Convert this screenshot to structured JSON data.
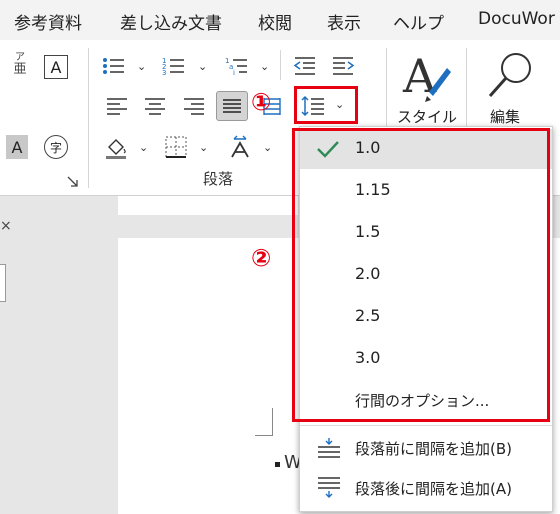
{
  "menu": {
    "items": [
      "参考資料",
      "差し込み文書",
      "校閲",
      "表示",
      "ヘルプ",
      "DocuWor"
    ]
  },
  "ribbon": {
    "phonetic_top": "ア",
    "phonetic_bottom": "亜",
    "char_border": "A",
    "char_shading": "A",
    "enclose_char": "字",
    "styles_label": "スタイル",
    "edit_label": "編集",
    "paragraph_group_label": "段落"
  },
  "annotations": {
    "marker1": "①",
    "marker2": "②",
    "accent": "#e60012"
  },
  "line_spacing_menu": {
    "selected": "1.0",
    "options": [
      "1.0",
      "1.15",
      "1.5",
      "2.0",
      "2.5",
      "3.0"
    ],
    "options_link": "行間のオプション...",
    "add_before": "段落前に間隔を追加(B)",
    "add_after": "段落後に間隔を追加(A)",
    "check_color": "#2e8b57"
  },
  "document": {
    "bullet_text": "W"
  }
}
